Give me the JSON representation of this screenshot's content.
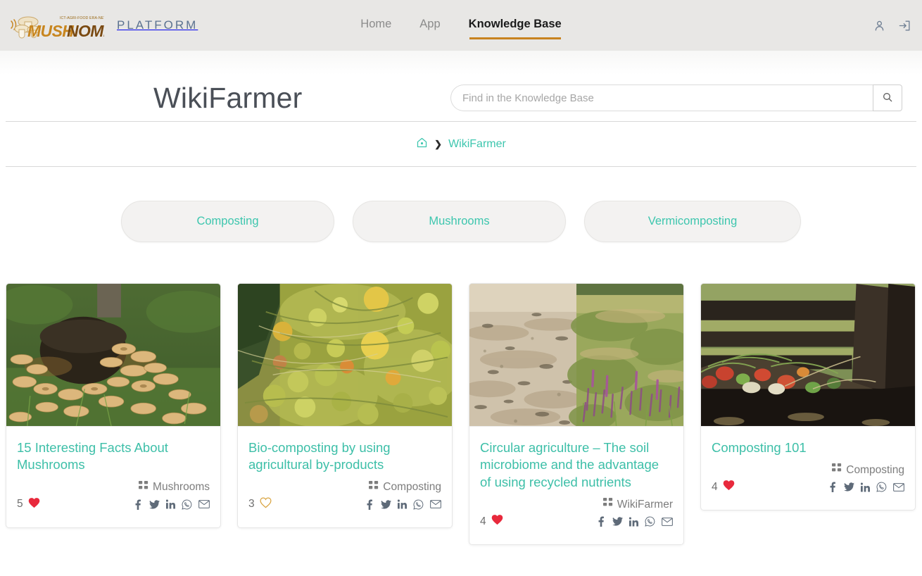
{
  "header": {
    "logo_mark": "mushroom-logo",
    "logo_sub": "ICT-AGRI-FOOD ERA-NET",
    "logo_word_1": "MUSH",
    "logo_word_2": "NOMICS",
    "platform_word": "PLATFORM",
    "nav": [
      {
        "label": "Home",
        "active": false
      },
      {
        "label": "App",
        "active": false
      },
      {
        "label": "Knowledge Base",
        "active": true
      }
    ],
    "account_icon": "user-icon",
    "login_icon": "login-icon",
    "accent_color": "#c8821e"
  },
  "page": {
    "title": "WikiFarmer",
    "title_color": "#4a4f57"
  },
  "search": {
    "placeholder": "Find in the Knowledge Base",
    "value": "",
    "button_icon": "search-icon"
  },
  "breadcrumb": {
    "home_icon": "home-icon",
    "separator": "❯",
    "current": "WikiFarmer",
    "link_color": "#3dc6ae"
  },
  "categories": [
    {
      "label": "Composting"
    },
    {
      "label": "Mushrooms"
    },
    {
      "label": "Vermicomposting"
    }
  ],
  "social_icons": [
    "facebook-icon",
    "twitter-icon",
    "linkedin-icon",
    "whatsapp-icon",
    "email-icon"
  ],
  "cards": [
    {
      "title": "15 Interesting Facts About Mushrooms",
      "image_alt": "mushroom-cluster-on-tree-stump",
      "category": "Mushrooms",
      "category_icon": "grid-icon",
      "likes": "5",
      "liked": true,
      "heart_color": "#e8293c"
    },
    {
      "title": "Bio-composting by using agricultural by-products",
      "image_alt": "compost-pile-with-apples",
      "category": "Composting",
      "category_icon": "grid-icon",
      "likes": "3",
      "liked": false,
      "heart_color": "#d9a441"
    },
    {
      "title": "Circular agriculture – The soil microbiome and the advantage of using recycled nutrients",
      "image_alt": "barren-sand-versus-heathland-split",
      "category": "WikiFarmer",
      "category_icon": "grid-icon",
      "likes": "4",
      "liked": true,
      "heart_color": "#e8293c"
    },
    {
      "title": "Composting 101",
      "image_alt": "wooden-compost-bin-with-vegetable-scraps",
      "category": "Composting",
      "category_icon": "grid-icon",
      "likes": "4",
      "liked": true,
      "heart_color": "#e8293c"
    }
  ]
}
